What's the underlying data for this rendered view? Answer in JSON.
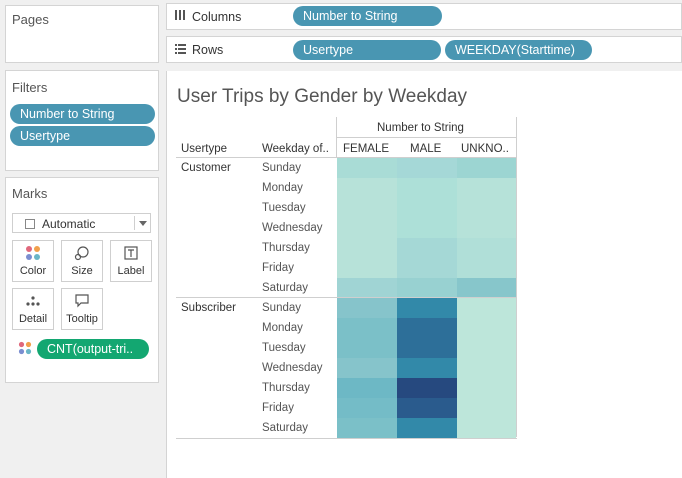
{
  "pages": {
    "title": "Pages"
  },
  "columns_shelf": {
    "label": "Columns",
    "pills": [
      "Number to String"
    ]
  },
  "rows_shelf": {
    "label": "Rows",
    "pills": [
      "Usertype",
      "WEEKDAY(Starttime)"
    ]
  },
  "filters": {
    "title": "Filters",
    "pills": [
      "Number to String",
      "Usertype"
    ]
  },
  "marks": {
    "title": "Marks",
    "mark_type": "Automatic",
    "buttons": [
      "Color",
      "Size",
      "Label",
      "Detail",
      "Tooltip"
    ],
    "field_pill": "CNT(output-tri.."
  },
  "view": {
    "title": "User Trips by Gender by Weekday",
    "col_group_header": "Number to String",
    "row_header_1": "Usertype",
    "row_header_2": "Weekday of..",
    "columns": [
      "FEMALE",
      "MALE",
      "UNKNO.."
    ]
  },
  "chart_data": {
    "type": "heatmap",
    "title": "User Trips by Gender by Weekday",
    "row_groups": [
      {
        "name": "Customer",
        "rows": [
          "Sunday",
          "Monday",
          "Tuesday",
          "Wednesday",
          "Thursday",
          "Friday",
          "Saturday"
        ]
      },
      {
        "name": "Subscriber",
        "rows": [
          "Sunday",
          "Monday",
          "Tuesday",
          "Wednesday",
          "Thursday",
          "Friday",
          "Saturday"
        ]
      }
    ],
    "columns": [
      "FEMALE",
      "MALE",
      "UNKNO.."
    ],
    "cell_colors": [
      [
        "#a9dcd6",
        "#a5d8d7",
        "#9cd5d2"
      ],
      [
        "#b7e2d9",
        "#ade0d8",
        "#b6e2d9"
      ],
      [
        "#b7e2d9",
        "#ade0d8",
        "#b6e2d9"
      ],
      [
        "#b7e2d9",
        "#ade0d8",
        "#b6e2d9"
      ],
      [
        "#b7e2d9",
        "#a5d8d6",
        "#b0dfd8"
      ],
      [
        "#b7e2d9",
        "#a5d8d6",
        "#b0dfd8"
      ],
      [
        "#a0d4d4",
        "#98d1d1",
        "#87c6cb"
      ],
      [
        "#86c4cb",
        "#3289a9",
        "#bde6da"
      ],
      [
        "#7bc0c8",
        "#2d6f99",
        "#bde6da"
      ],
      [
        "#7bc0c8",
        "#2d6f99",
        "#bde6da"
      ],
      [
        "#86c4cb",
        "#3289a9",
        "#bde6da"
      ],
      [
        "#6db8c5",
        "#26497f",
        "#bde6da"
      ],
      [
        "#74bcc7",
        "#2a5b8d",
        "#bde6da"
      ],
      [
        "#7bc0c8",
        "#3289a9",
        "#bde6da"
      ]
    ]
  }
}
